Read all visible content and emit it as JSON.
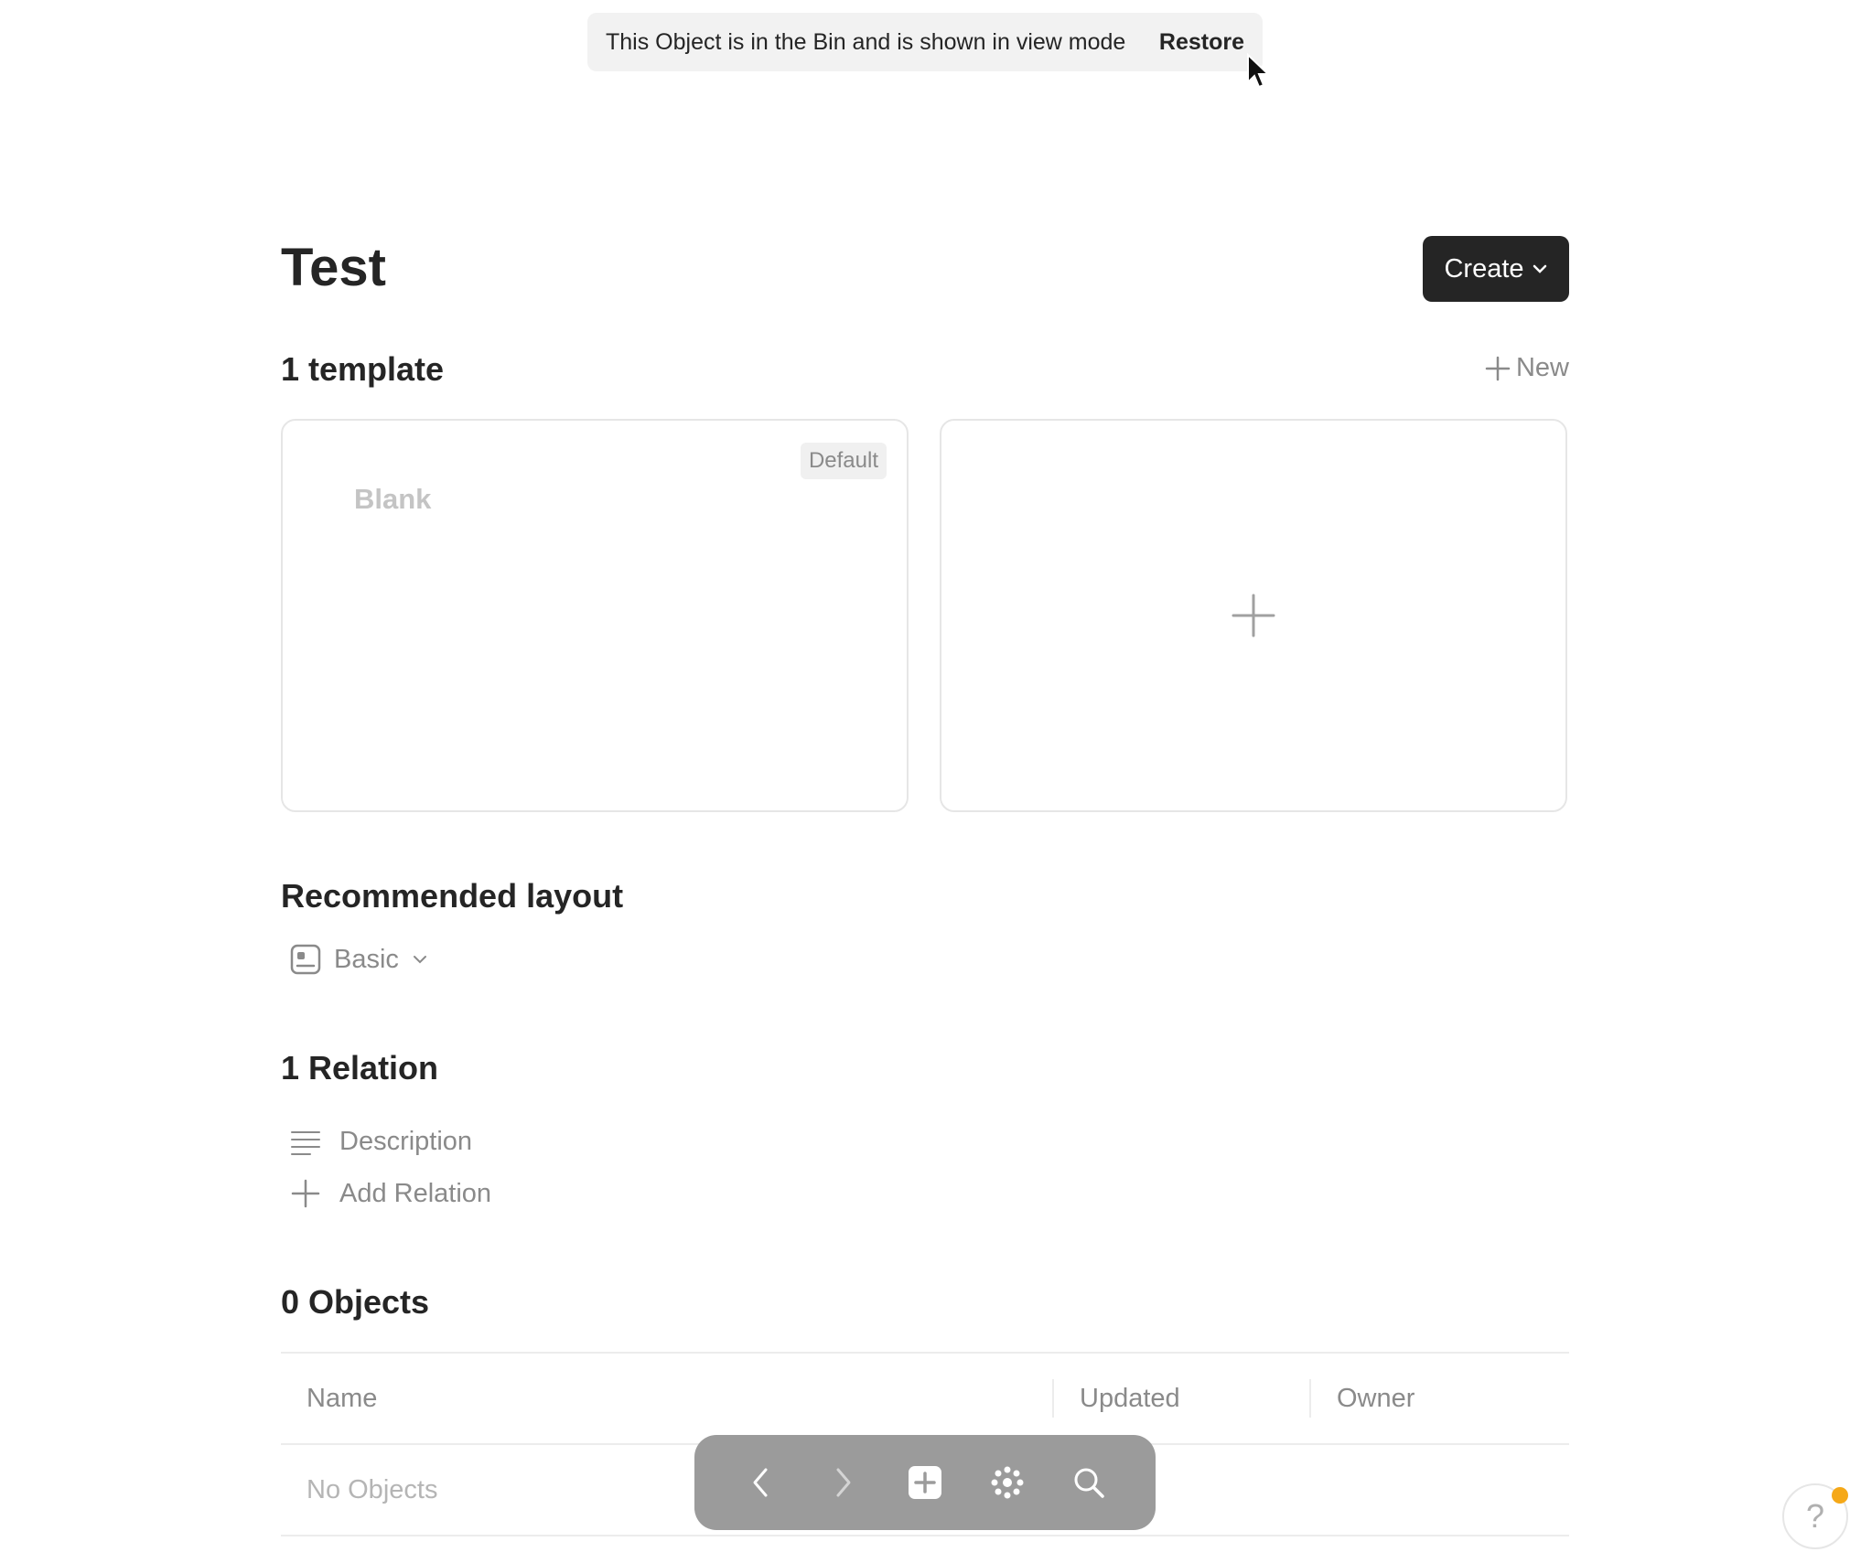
{
  "banner": {
    "message": "This Object is in the Bin and is shown in view mode",
    "restore_label": "Restore"
  },
  "page": {
    "title": "Test",
    "create_label": "Create"
  },
  "templates": {
    "heading": "1 template",
    "new_label": "New",
    "items": [
      {
        "name": "Blank",
        "badge": "Default"
      }
    ]
  },
  "layout": {
    "heading": "Recommended layout",
    "value": "Basic"
  },
  "relations": {
    "heading": "1 Relation",
    "items": [
      {
        "label": "Description",
        "icon": "text-lines-icon"
      }
    ],
    "add_label": "Add Relation"
  },
  "objects": {
    "heading": "0 Objects",
    "columns": [
      "Name",
      "Updated",
      "Owner"
    ],
    "empty_text": "No Objects"
  },
  "navbar": {
    "icons": [
      "back-arrow-icon",
      "forward-arrow-icon",
      "add-square-icon",
      "graph-icon",
      "search-icon"
    ]
  },
  "help": {
    "label": "?"
  },
  "colors": {
    "accent_dark": "#252525",
    "notification_dot": "#f5a818",
    "navbar_bg": "#9b9b9b"
  }
}
